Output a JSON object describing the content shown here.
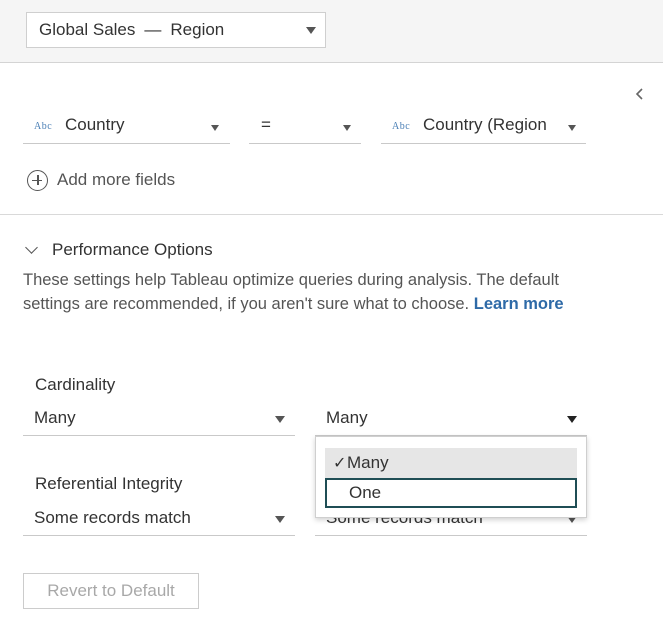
{
  "datasource": {
    "name": "Global Sales",
    "separator": "—",
    "table": "Region"
  },
  "join_clause": {
    "left_field": {
      "type_icon": "Abc",
      "name": "Country"
    },
    "operator": "=",
    "right_field": {
      "type_icon": "Abc",
      "name": "Country (Region"
    }
  },
  "add_more_fields_label": "Add more fields",
  "performance": {
    "title": "Performance Options",
    "description": "These settings help Tableau optimize queries during analysis. The default settings are recommended, if you aren't sure what to choose.",
    "learn_more": "Learn more",
    "cardinality": {
      "label": "Cardinality",
      "left_value": "Many",
      "right_value": "Many"
    },
    "referential_integrity": {
      "label": "Referential Integrity",
      "left_value": "Some records match",
      "right_value": "Some records match"
    },
    "dropdown": {
      "check_mark": "✓",
      "options": [
        {
          "label": "Many",
          "selected": true
        },
        {
          "label": "One",
          "selected": false,
          "focused": true
        }
      ]
    },
    "revert_label": "Revert to Default"
  },
  "colors": {
    "link": "#2e6aa7",
    "focus_outline": "#1f4e55",
    "abc_icon": "#4a7fb5"
  }
}
